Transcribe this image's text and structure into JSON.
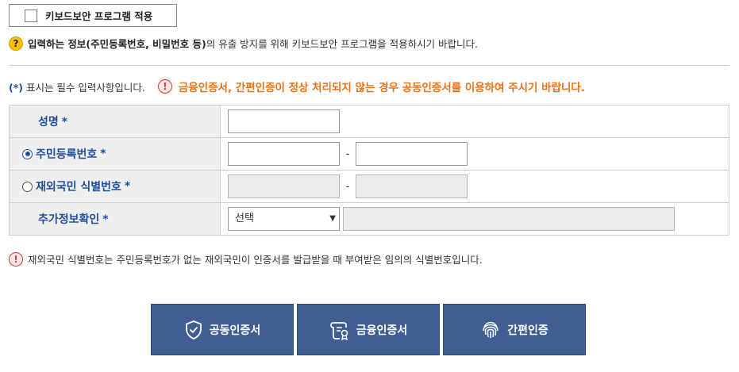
{
  "keyboard_security": {
    "label": "키보드보안 프로그램 적용",
    "checked": false
  },
  "info": {
    "icon": "question-icon",
    "strong_text": "입력하는 정보(주민등록번호, 비밀번호 등)",
    "rest_text": "의 유출 방지를 위해 키보드보안 프로그램을 적용하시기 바랍니다."
  },
  "required_note": {
    "star": "(*)",
    "text": " 표시는 필수 입력사항입니다."
  },
  "warning": {
    "icon": "exclamation-icon",
    "text": "금융인증서, 간편인증이 정상 처리되지 않는 경우 공동인증서를 이용하여 주시기 바랍니다."
  },
  "form": {
    "name_label": "성명",
    "rrn_label": "주민등록번호",
    "foreign_label": "재외국민 식별번호",
    "extra_label": "추가정보확인",
    "required_star": "*",
    "dash": "-",
    "select_value": "선택",
    "selected_id_type": "rrn"
  },
  "footer_note": {
    "icon": "exclamation-icon",
    "text": "재외국민 식별번호는 주민등록번호가 없는 재외국민이 인증서를 발급받을 때 부여받은 임의의 식별번호입니다."
  },
  "buttons": {
    "joint_cert": "공동인증서",
    "financial_cert": "금융인증서",
    "simple_auth": "간편인증"
  },
  "colors": {
    "brand_blue": "#1f4e9e",
    "button_bg": "#3f5f93",
    "warning_orange": "#e8731a"
  }
}
